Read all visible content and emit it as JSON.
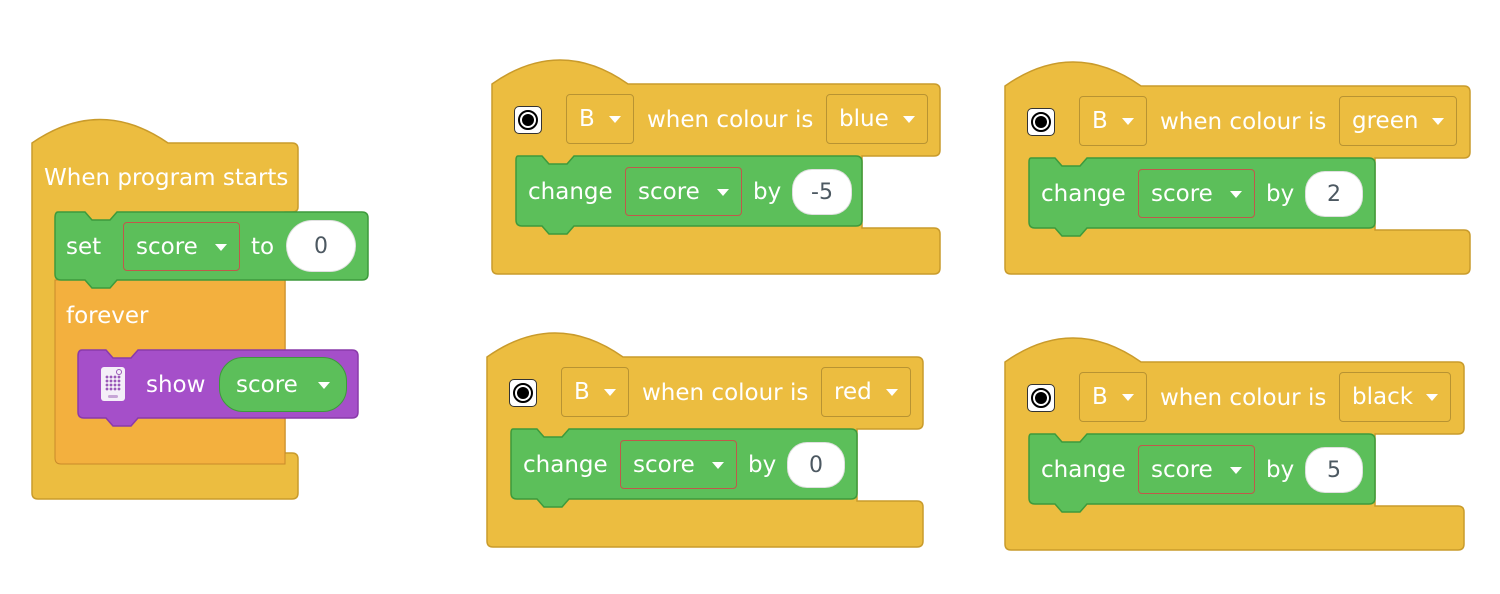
{
  "colors": {
    "event": "#ecbd40",
    "event_stroke": "#c99b2b",
    "operator": "#5cbf5a",
    "operator_stroke": "#3d9a3c",
    "control": "#f3b03e",
    "display": "#a54fc9",
    "display_stroke": "#8a3aaa",
    "value_text": "#4c5861"
  },
  "main_script": {
    "hat": "When program starts",
    "set_block": {
      "label": "set",
      "variable": "score",
      "connector": "to",
      "value": "0"
    },
    "loop": {
      "label": "forever"
    },
    "show_block": {
      "icon": "light-matrix-icon",
      "label": "show",
      "variable": "score"
    }
  },
  "color_scripts": [
    {
      "sensor_icon": "color-sensor-icon",
      "port": "B",
      "condition": "when colour is",
      "color": "blue",
      "action": {
        "label": "change",
        "variable": "score",
        "connector": "by",
        "value": "-5"
      }
    },
    {
      "sensor_icon": "color-sensor-icon",
      "port": "B",
      "condition": "when colour is",
      "color": "green",
      "action": {
        "label": "change",
        "variable": "score",
        "connector": "by",
        "value": "2"
      }
    },
    {
      "sensor_icon": "color-sensor-icon",
      "port": "B",
      "condition": "when colour is",
      "color": "red",
      "action": {
        "label": "change",
        "variable": "score",
        "connector": "by",
        "value": "0"
      }
    },
    {
      "sensor_icon": "color-sensor-icon",
      "port": "B",
      "condition": "when colour is",
      "color": "black",
      "action": {
        "label": "change",
        "variable": "score",
        "connector": "by",
        "value": "5"
      }
    }
  ]
}
